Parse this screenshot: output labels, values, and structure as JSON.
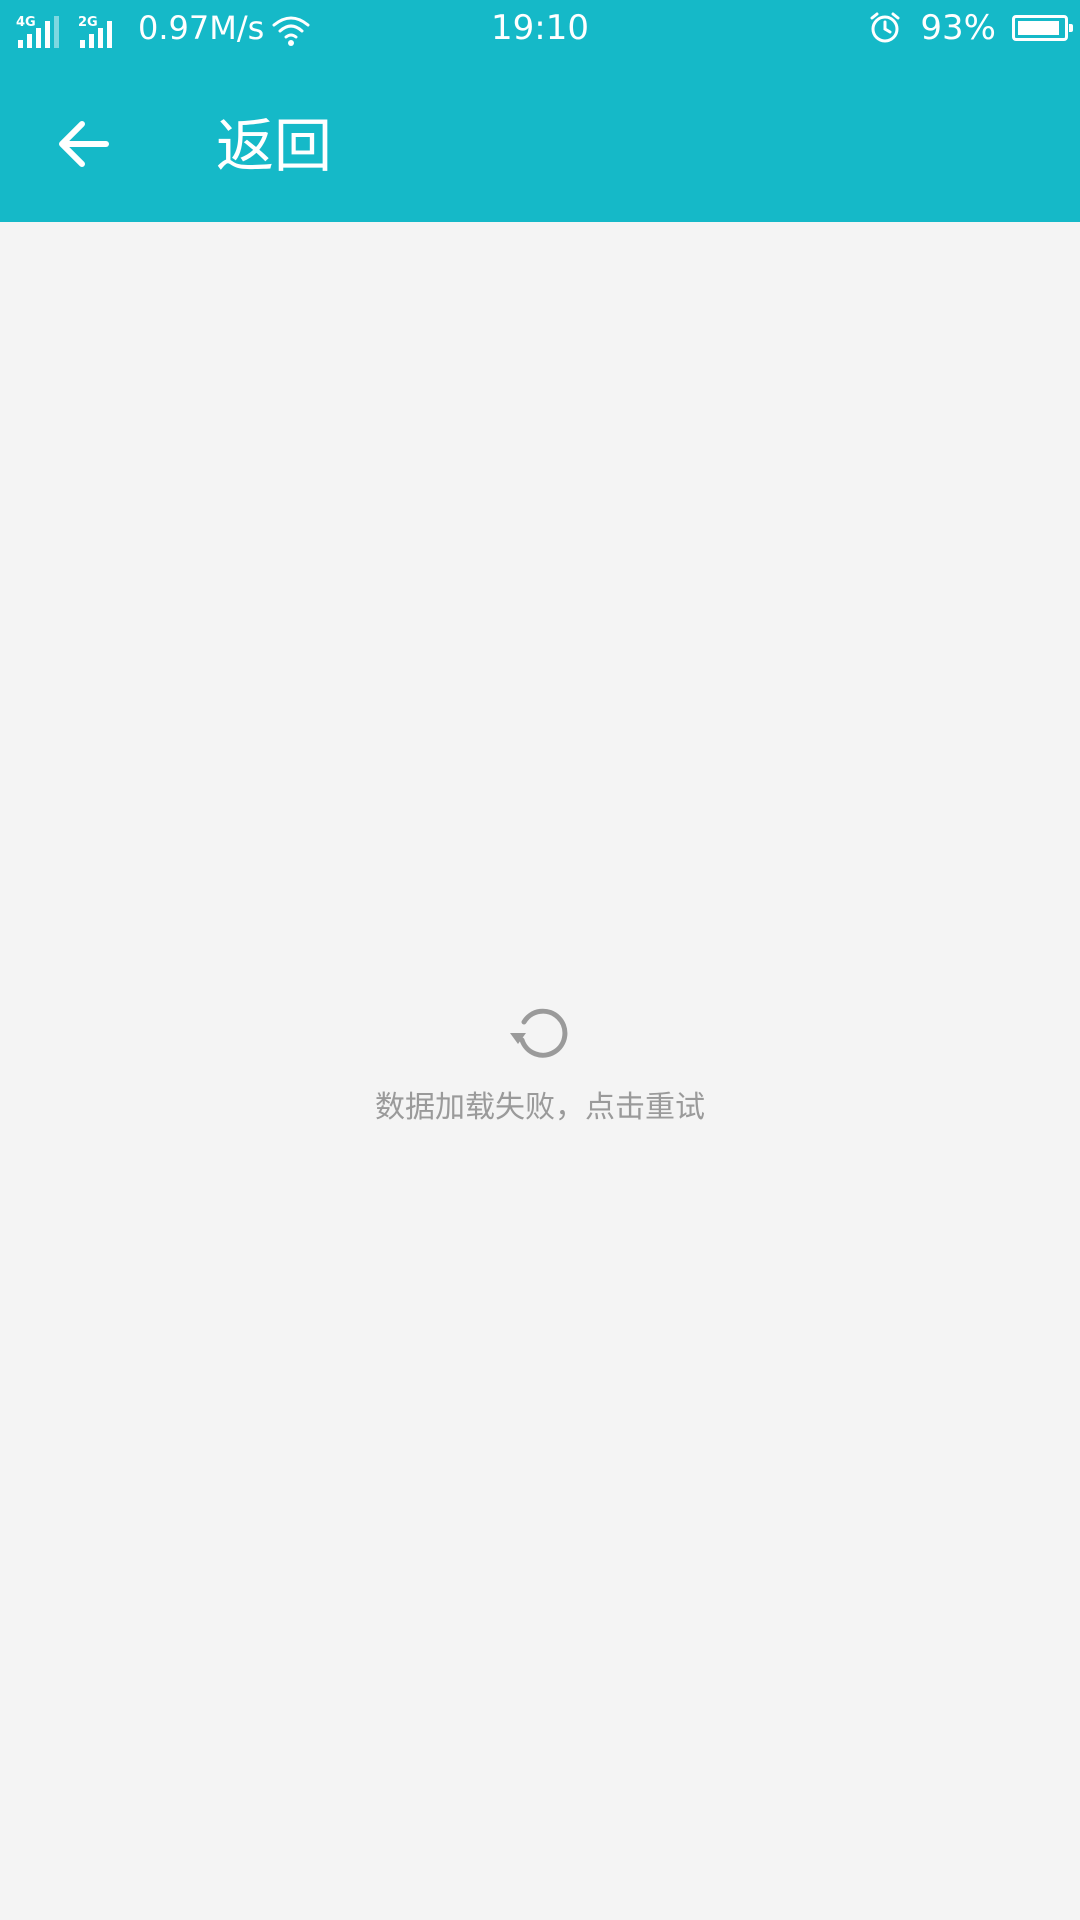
{
  "status_bar": {
    "network1": "4G",
    "network2": "2G",
    "speed": "0.97M/s",
    "time": "19:10",
    "battery_percent": "93%",
    "battery_level": 0.93,
    "icons": [
      "signal-icon",
      "signal-icon",
      "wifi-icon",
      "alarm-icon",
      "battery-icon"
    ]
  },
  "app_bar": {
    "back_icon": "arrow-left-icon",
    "back_label": "返回",
    "color": "#15b9c8"
  },
  "content": {
    "retry_icon": "refresh-icon",
    "error_message": "数据加载失败，点击重试"
  }
}
